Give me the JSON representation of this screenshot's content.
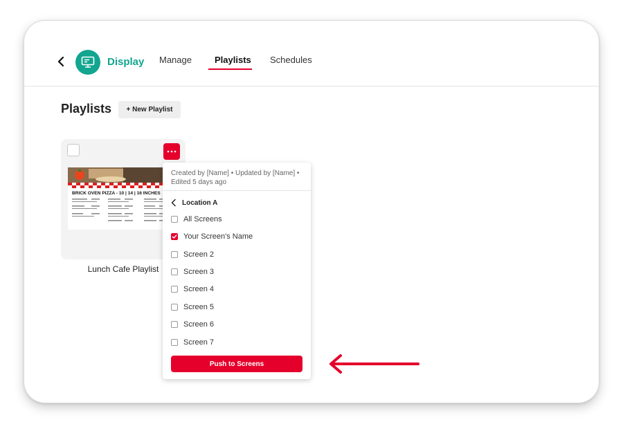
{
  "header": {
    "app_name": "Display",
    "tabs": [
      {
        "label": "Manage",
        "active": false
      },
      {
        "label": "Playlists",
        "active": true
      },
      {
        "label": "Schedules",
        "active": false
      }
    ]
  },
  "page": {
    "title": "Playlists",
    "new_button": "+ New Playlist"
  },
  "playlist": {
    "name": "Lunch Cafe Playlist",
    "thumbnail_heading": "BRICK OVEN PIZZA - 10 | 14 | 16 INCHES"
  },
  "menu": {
    "meta": "Created by [Name] • Updated by [Name] • Edited 5 days ago",
    "location": "Location A",
    "screens": [
      {
        "label": "All Screens",
        "checked": false
      },
      {
        "label": "Your Screen's Name",
        "checked": true
      },
      {
        "label": "Screen 2",
        "checked": false
      },
      {
        "label": "Screen 3",
        "checked": false
      },
      {
        "label": "Screen 4",
        "checked": false
      },
      {
        "label": "Screen 5",
        "checked": false
      },
      {
        "label": "Screen 6",
        "checked": false
      },
      {
        "label": "Screen 7",
        "checked": false
      }
    ],
    "push_button": "Push to Screens"
  },
  "colors": {
    "accent": "#e5002b",
    "brand": "#12a58f"
  }
}
